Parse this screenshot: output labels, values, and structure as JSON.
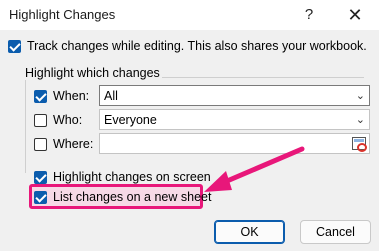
{
  "window": {
    "title": "Highlight Changes",
    "help_glyph": "?",
    "close_glyph": "✕"
  },
  "track": {
    "label": "Track changes while editing. This also shares your workbook.",
    "checked": true
  },
  "group": {
    "title": "Highlight which changes"
  },
  "when": {
    "label": "When:",
    "checked": true,
    "value": "All"
  },
  "who": {
    "label": "Who:",
    "checked": false,
    "value": "Everyone"
  },
  "where": {
    "label": "Where:",
    "checked": false,
    "value": ""
  },
  "highlight_on_screen": {
    "label": "Highlight changes on screen",
    "checked": true
  },
  "list_new_sheet": {
    "label": "List changes on a new sheet",
    "checked": true
  },
  "buttons": {
    "ok": "OK",
    "cancel": "Cancel"
  },
  "colors": {
    "accent": "#0b5cad",
    "annotation": "#e8177a"
  }
}
